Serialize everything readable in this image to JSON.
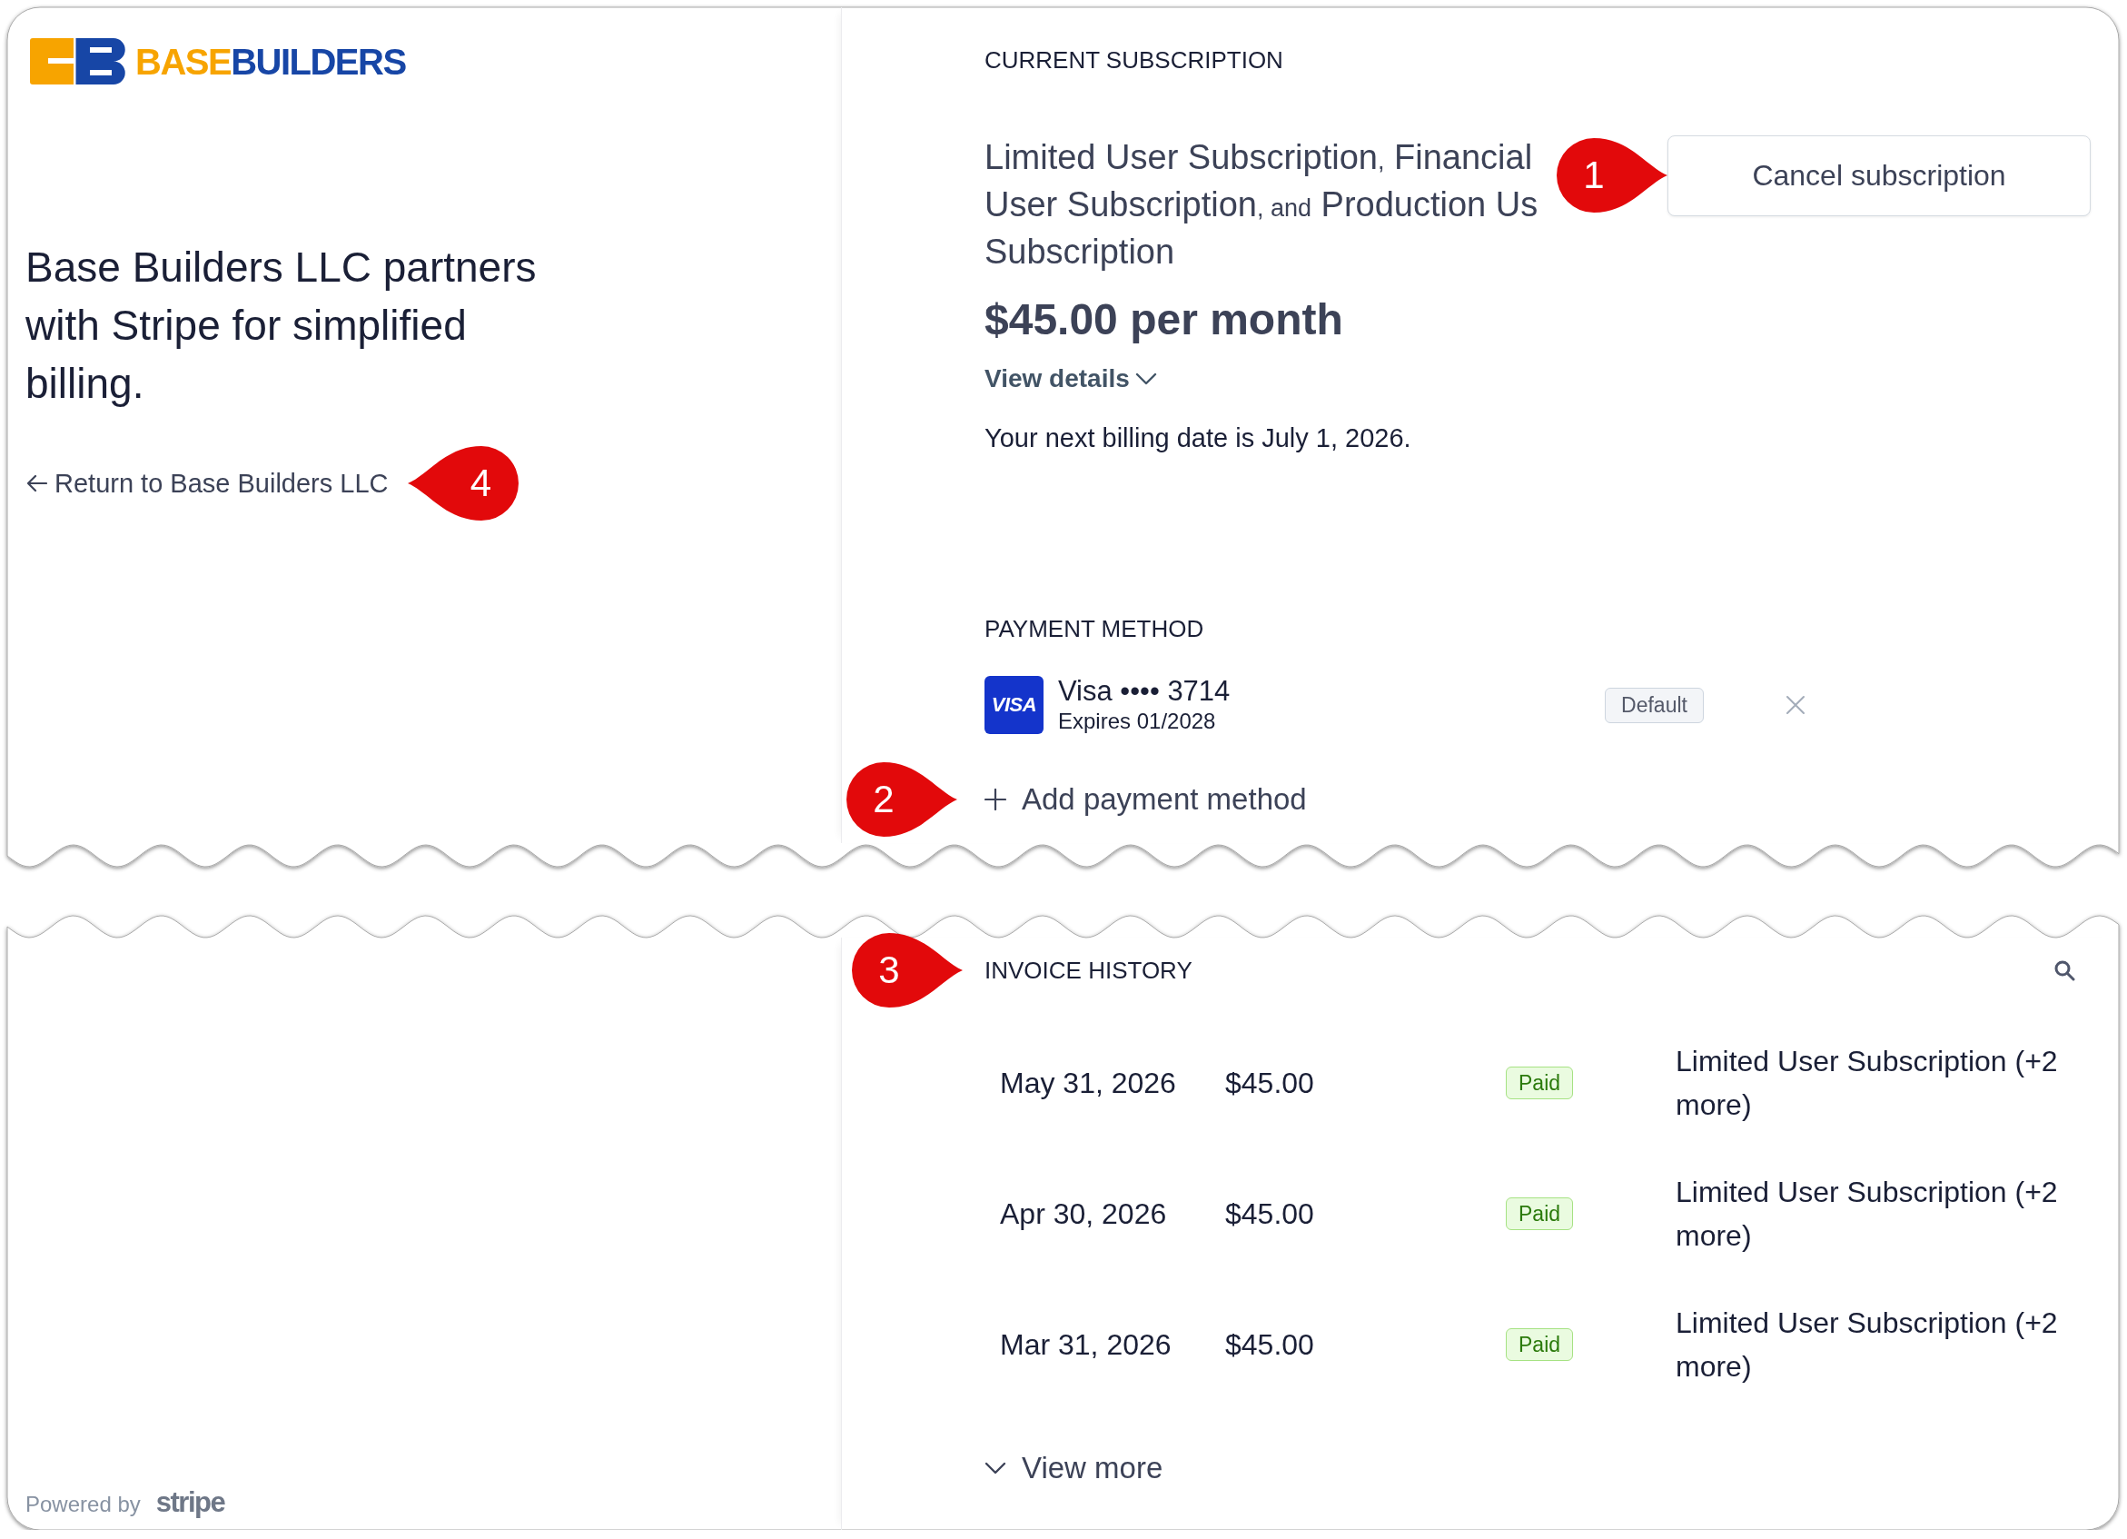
{
  "brand": {
    "logo_text": [
      "BASE",
      "BUILDERS"
    ]
  },
  "intro": {
    "headline": "Base Builders LLC partners with Stripe for simplified billing.",
    "return_link": {
      "label": "Return to Base Builders LLC",
      "callout": "4"
    }
  },
  "current_subscription": {
    "heading": "CURRENT SUBSCRIPTION",
    "plan_names": [
      {
        "kind": "name",
        "text": "Limited User Subscription"
      },
      {
        "kind": "separator",
        "text": ","
      },
      {
        "kind": "name",
        "text": "Financial User Subscription"
      },
      {
        "kind": "separator",
        "text": ", and"
      },
      {
        "kind": "name",
        "text": "Production Us Subscription"
      }
    ],
    "cancel_button": {
      "label": "Cancel subscription",
      "callout": "1"
    },
    "price": "$45.00 per month",
    "details_toggle": {
      "label": "View details",
      "expanded": false
    },
    "next_billing": "Your next billing date is July 1, 2026."
  },
  "payment_method": {
    "heading": "PAYMENT METHOD",
    "cards": [
      {
        "brand_mark": "VISA",
        "label": "Visa •••• 3714",
        "expiry": "Expires 01/2028",
        "badge": "Default"
      }
    ],
    "add_button": {
      "label": "Add payment method",
      "callout": "2"
    }
  },
  "invoice_history": {
    "heading": "INVOICE HISTORY",
    "callout": "3",
    "rows": [
      {
        "date": "May 31, 2026",
        "amount": "$45.00",
        "status": "Paid",
        "description": "Limited User Subscription (+2 more)"
      },
      {
        "date": "Apr 30, 2026",
        "amount": "$45.00",
        "status": "Paid",
        "description": "Limited User Subscription (+2 more)"
      },
      {
        "date": "Mar 31, 2026",
        "amount": "$45.00",
        "status": "Paid",
        "description": "Limited User Subscription (+2 more)"
      }
    ],
    "view_more": {
      "label": "View more"
    }
  },
  "footer": {
    "powered_by": "Powered by",
    "wordmark": "stripe"
  }
}
